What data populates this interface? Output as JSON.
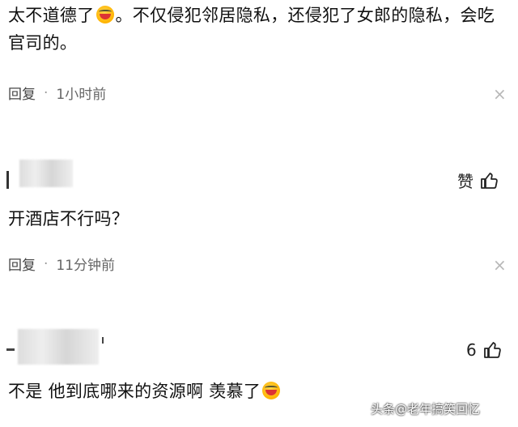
{
  "comments": [
    {
      "text_a": "太不道德了",
      "text_b": "。不仅侵犯邻居隐私，还侵犯了女郎的隐私，会吃官司的。",
      "reply_label": "回复",
      "dot": "·",
      "time": "1小时前",
      "close": "×"
    },
    {
      "like_label": "赞",
      "text": "开酒店不行吗？",
      "reply_label": "回复",
      "dot": "·",
      "time": "11分钟前",
      "close": "×"
    },
    {
      "like_count": "6",
      "text": "不是 他到底哪来的资源啊 羡慕了"
    }
  ],
  "icons": {
    "emoji": "laughing-crying-emoji",
    "like": "thumbs-up-icon",
    "close": "close-icon"
  },
  "watermark": "头条@老年搞笑回忆"
}
